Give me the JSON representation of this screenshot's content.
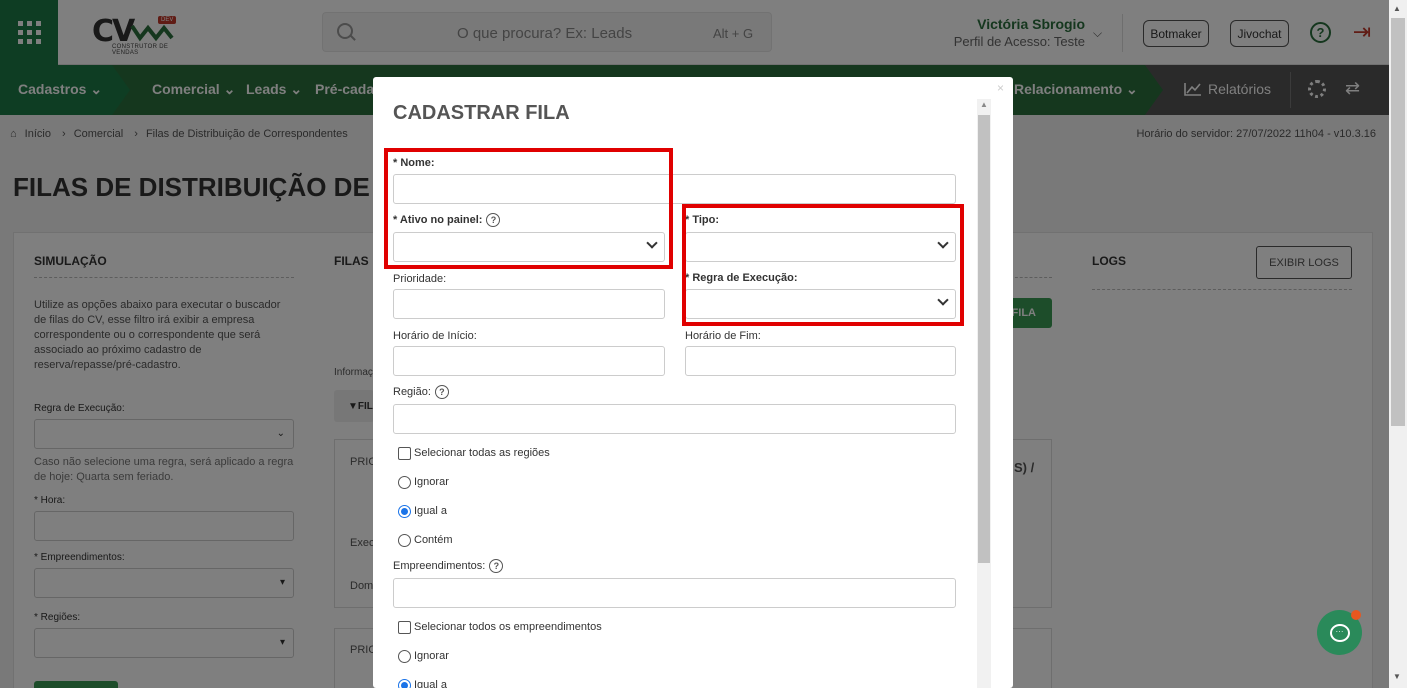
{
  "header": {
    "logo_text": "CV",
    "logo_badge": "DEV",
    "logo_subtitle": "CONSTRUTOR DE VENDAS",
    "search_placeholder": "O que procura? Ex: Leads",
    "search_shortcut": "Alt + G",
    "user_name": "Victória Sbrogio",
    "user_profile": "Perfil de Acesso: Teste",
    "buttons": [
      "Botmaker",
      "Jivochat"
    ],
    "help_icon": "?",
    "logout_icon": "⇥"
  },
  "nav": {
    "items": [
      "Cadastros",
      "Comercial",
      "Leads",
      "Pré-cadas",
      "Relacionamento"
    ],
    "reports": "Relatórios"
  },
  "breadcrumb": [
    "Início",
    "Comercial",
    "Filas de Distribuição de Correspondentes"
  ],
  "server_time": "Horário do servidor: 27/07/2022 11h04 - v10.3.16",
  "page_title": "FILAS DE DISTRIBUIÇÃO DE CO",
  "background": {
    "simulacao_title": "SIMULAÇÃO",
    "filas_title": "FILAS",
    "logs_title": "LOGS",
    "logs_button": "EXIBIR LOGS",
    "fila_button": "FILA",
    "simulacao_desc": "Utilize as opções abaixo para executar o buscador de filas do CV, esse filtro irá exibir a empresa correspondente ou o correspondente que será associado ao próximo cadastro de reserva/repasse/pré-cadastro.",
    "regra_label": "Regra de Execução:",
    "regra_hint": "Caso não selecione uma regra, será aplicado a regra de hoje: Quarta sem feriado.",
    "hora_label": "* Hora:",
    "emp_label": "* Empreendimentos:",
    "reg_label": "* Regiões:",
    "frag_informa": "Informaç",
    "frag_fil": "FIL",
    "frag_prio1": "PRIO",
    "frag_exec": "Exec",
    "frag_dom": "Dom",
    "frag_prio2": "PRIO",
    "frag_s": "S) /"
  },
  "modal": {
    "title": "CADASTRAR FILA",
    "close": "×",
    "fields": {
      "nome": "* Nome:",
      "ativo": "* Ativo no painel:",
      "tipo": "* Tipo:",
      "prioridade": "Prioridade:",
      "regra": "* Regra de Execução:",
      "inicio": "Horário de Início:",
      "fim": "Horário de Fim:",
      "regiao": "Região:",
      "empreendimentos": "Empreendimentos:"
    },
    "regiao_options": {
      "select_all": "Selecionar todas as regiões",
      "radios": [
        "Ignorar",
        "Igual a",
        "Contém"
      ],
      "selected": "Igual a"
    },
    "emp_options": {
      "select_all": "Selecionar todos os empreendimentos",
      "radios": [
        "Ignorar",
        "Igual a"
      ],
      "selected": "Igual a"
    }
  },
  "colors": {
    "primary_green": "#2a6e3d",
    "highlight_red": "#e00000",
    "radio_blue": "#1a73e8"
  }
}
